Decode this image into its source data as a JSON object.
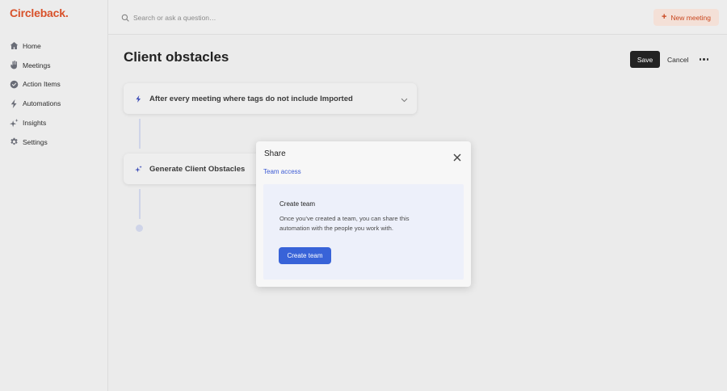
{
  "app": {
    "logo_text": "Circleback",
    "logo_dot": ".",
    "brand_color": "#d8512a"
  },
  "sidebar": {
    "items": [
      {
        "label": "Home",
        "icon": "home-icon"
      },
      {
        "label": "Meetings",
        "icon": "meetings-icon"
      },
      {
        "label": "Action Items",
        "icon": "check-circle-icon"
      },
      {
        "label": "Automations",
        "icon": "lightning-icon"
      },
      {
        "label": "Insights",
        "icon": "sparkle-icon"
      },
      {
        "label": "Settings",
        "icon": "gear-icon"
      }
    ]
  },
  "topbar": {
    "search_placeholder": "Search or ask a question…",
    "new_meeting_label": "New meeting"
  },
  "main": {
    "title": "Client obstacles",
    "save_label": "Save",
    "cancel_label": "Cancel",
    "trigger_card_text": "After every meeting where tags do not include Imported",
    "action_card_text": "Generate Client Obstacles"
  },
  "modal": {
    "title": "Share",
    "tab_label": "Team access",
    "panel_title": "Create team",
    "panel_description": "Once you've created a team, you can share this automation with the people you work with.",
    "create_team_label": "Create team",
    "accent_color": "#3863d8"
  }
}
